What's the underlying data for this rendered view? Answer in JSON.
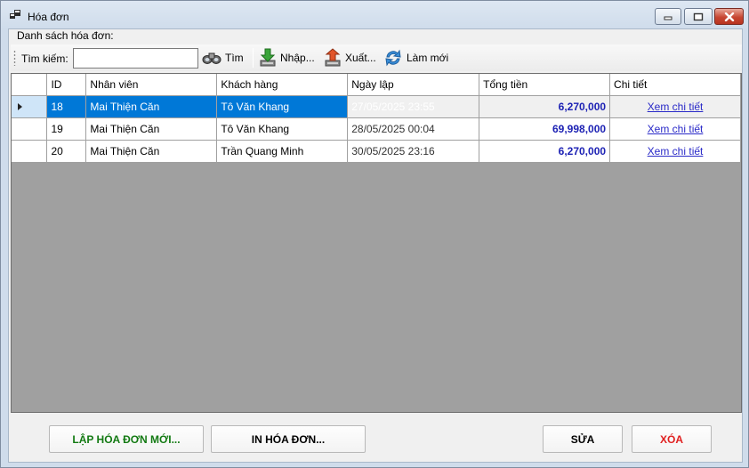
{
  "window": {
    "title": "Hóa đơn"
  },
  "group": {
    "label": "Danh sách hóa đơn:"
  },
  "toolbar": {
    "search_label": "Tìm kiếm:",
    "search_value": "",
    "search_btn": "Tìm",
    "import_btn": "Nhập...",
    "export_btn": "Xuất...",
    "refresh_btn": "Làm mới"
  },
  "grid": {
    "columns": [
      "ID",
      "Nhân viên",
      "Khách hàng",
      "Ngày lập",
      "Tổng tiền",
      "Chi tiết"
    ],
    "selected_row": 0,
    "rows": [
      {
        "id": "18",
        "employee": "Mai Thiện Căn",
        "customer": "Tô Văn Khang",
        "date": "27/05/2025 23:55",
        "total": "6,270,000",
        "detail": "Xem chi tiết"
      },
      {
        "id": "19",
        "employee": "Mai Thiện Căn",
        "customer": "Tô Văn Khang",
        "date": "28/05/2025 00:04",
        "total": "69,998,000",
        "detail": "Xem chi tiết"
      },
      {
        "id": "20",
        "employee": "Mai Thiện Căn",
        "customer": "Trần Quang Minh",
        "date": "30/05/2025 23:16",
        "total": "6,270,000",
        "detail": "Xem chi tiết"
      }
    ]
  },
  "buttons": {
    "create": "LẬP HÓA ĐƠN MỚI...",
    "print": "IN HÓA ĐƠN...",
    "edit": "SỬA",
    "delete": "XÓA"
  },
  "colors": {
    "selection": "#0078d7",
    "total_text": "#1d22b4",
    "create_text": "#137a13",
    "delete_text": "#e02020"
  },
  "icons": [
    "app-icon",
    "minimize-icon",
    "maximize-icon",
    "close-icon",
    "binoculars-icon",
    "import-icon",
    "export-icon",
    "refresh-icon",
    "row-pointer-icon"
  ]
}
